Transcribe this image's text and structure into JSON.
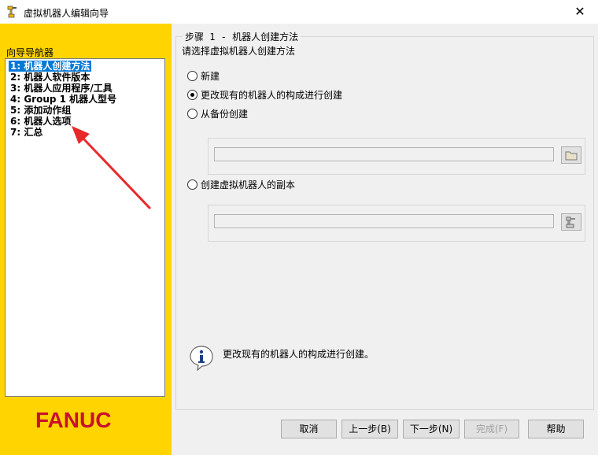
{
  "window": {
    "title": "虚拟机器人编辑向导",
    "close_glyph": "✕"
  },
  "nav": {
    "header": "向导导航器",
    "items": [
      {
        "label": "1: 机器人创建方法",
        "selected": true
      },
      {
        "label": "2: 机器人软件版本",
        "selected": false
      },
      {
        "label": "3: 机器人应用程序/工具",
        "selected": false
      },
      {
        "label": "4: Group 1 机器人型号",
        "selected": false
      },
      {
        "label": "5: 添加动作组",
        "selected": false
      },
      {
        "label": "6: 机器人选项",
        "selected": false
      },
      {
        "label": "7: 汇总",
        "selected": false
      }
    ]
  },
  "brand": {
    "logo_text": "FANUC",
    "logo_color": "#c8102e",
    "panel_color": "#ffd400"
  },
  "step": {
    "legend": "步骤 1 - 机器人创建方法",
    "instruction": "请选择虚拟机器人创建方法",
    "options": [
      {
        "label": "新建",
        "checked": false
      },
      {
        "label": "更改现有的机器人的构成进行创建",
        "checked": true
      },
      {
        "label": "从备份创建",
        "checked": false
      },
      {
        "label": "创建虚拟机器人的副本",
        "checked": false
      }
    ],
    "backup_path": "",
    "copy_path": "",
    "info_text": "更改现有的机器人的构成进行创建。"
  },
  "buttons": {
    "cancel": "取消",
    "back": "上一步(B)",
    "next": "下一步(N)",
    "finish": "完成(F)",
    "help": "帮助"
  },
  "annotation": {
    "arrow_color": "#e8292b",
    "icon": "red-arrow-annotation"
  }
}
